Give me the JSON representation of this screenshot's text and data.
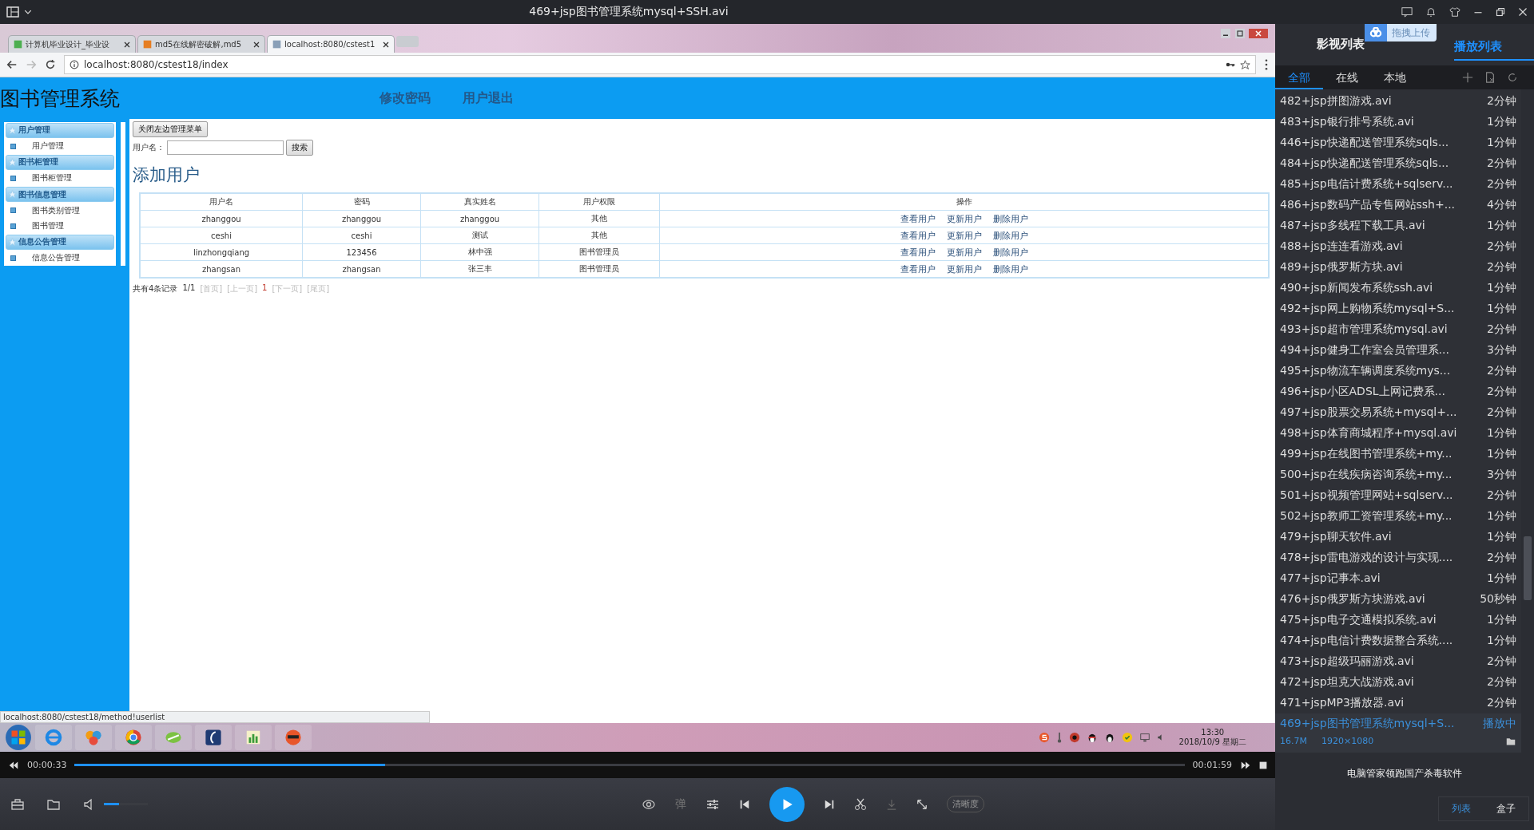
{
  "player": {
    "title": "469+jsp图书管理系统mysql+SSH.avi"
  },
  "browser": {
    "tabs": [
      {
        "label": "计算机毕业设计_毕业设",
        "selected": false
      },
      {
        "label": "md5在线解密破解,md5",
        "selected": false
      },
      {
        "label": "localhost:8080/cstest1",
        "selected": true
      }
    ],
    "url": "localhost:8080/cstest18/index",
    "status_url": "localhost:8080/cstest18/method!userlist"
  },
  "site": {
    "title": "图书管理系统",
    "nav": [
      "修改密码",
      "用户退出"
    ],
    "sidebar": [
      {
        "label": "用户管理",
        "children": [
          {
            "label": "用户管理"
          }
        ]
      },
      {
        "label": "图书柜管理",
        "children": [
          {
            "label": "图书柜管理"
          }
        ]
      },
      {
        "label": "图书信息管理",
        "children": [
          {
            "label": "图书类别管理"
          },
          {
            "label": "图书管理"
          }
        ]
      },
      {
        "label": "信息公告管理",
        "children": [
          {
            "label": "信息公告管理"
          }
        ]
      }
    ],
    "close_menu_button": "关闭左边管理菜单",
    "search": {
      "label": "用户名：",
      "button": "搜索"
    },
    "heading": "添加用户",
    "table": {
      "columns": [
        "用户名",
        "密码",
        "真实姓名",
        "用户权限",
        "操作"
      ],
      "rows": [
        {
          "cells": [
            "zhanggou",
            "zhanggou",
            "zhanggou",
            "其他"
          ],
          "actions": [
            "查看用户",
            "更新用户",
            "删除用户"
          ]
        },
        {
          "cells": [
            "ceshi",
            "ceshi",
            "测试",
            "其他"
          ],
          "actions": [
            "查看用户",
            "更新用户",
            "删除用户"
          ]
        },
        {
          "cells": [
            "linzhongqiang",
            "123456",
            "林中强",
            "图书管理员"
          ],
          "actions": [
            "查看用户",
            "更新用户",
            "删除用户"
          ]
        },
        {
          "cells": [
            "zhangsan",
            "zhangsan",
            "张三丰",
            "图书管理员"
          ],
          "actions": [
            "查看用户",
            "更新用户",
            "删除用户"
          ]
        }
      ]
    },
    "pagination": {
      "summary": "共有4条记录",
      "pages": "1/1",
      "links": [
        {
          "label": "[首页]",
          "kind": "disabled"
        },
        {
          "label": "[上一页]",
          "kind": "disabled"
        },
        {
          "label": "1",
          "kind": "current"
        },
        {
          "label": "[下一页]",
          "kind": "disabled"
        },
        {
          "label": "[尾页]",
          "kind": "disabled"
        }
      ]
    }
  },
  "taskbar": {
    "time": "13:30",
    "date": "2018/10/9 星期二"
  },
  "playback": {
    "elapsed": "00:00:33",
    "total": "00:01:59",
    "level": 0.28,
    "volume": {
      "level": 0.35
    },
    "danmaku": "弹",
    "quality": "清晰度"
  },
  "panel": {
    "tabs": [
      {
        "label": "影视列表",
        "selected": false
      },
      {
        "label": "播放列表",
        "selected": true
      }
    ],
    "upload_button": "拖拽上传",
    "filters": [
      {
        "label": "全部",
        "selected": true
      },
      {
        "label": "在线",
        "selected": false
      },
      {
        "label": "本地",
        "selected": false
      }
    ],
    "items": [
      {
        "title": "482+jsp拼图游戏.avi",
        "duration": "2分钟",
        "selected": false
      },
      {
        "title": "483+jsp银行排号系统.avi",
        "duration": "1分钟",
        "selected": false
      },
      {
        "title": "446+jsp快递配送管理系统sqls...",
        "duration": "1分钟",
        "selected": false
      },
      {
        "title": "484+jsp快递配送管理系统sqls...",
        "duration": "2分钟",
        "selected": false
      },
      {
        "title": "485+jsp电信计费系统+sqlserv...",
        "duration": "2分钟",
        "selected": false
      },
      {
        "title": "486+jsp数码产品专售网站ssh+...",
        "duration": "4分钟",
        "selected": false
      },
      {
        "title": "487+jsp多线程下载工具.avi",
        "duration": "1分钟",
        "selected": false
      },
      {
        "title": "488+jsp连连看游戏.avi",
        "duration": "2分钟",
        "selected": false
      },
      {
        "title": "489+jsp俄罗斯方块.avi",
        "duration": "2分钟",
        "selected": false
      },
      {
        "title": "490+jsp新闻发布系统ssh.avi",
        "duration": "1分钟",
        "selected": false
      },
      {
        "title": "492+jsp网上购物系统mysql+S...",
        "duration": "1分钟",
        "selected": false
      },
      {
        "title": "493+jsp超市管理系统mysql.avi",
        "duration": "2分钟",
        "selected": false
      },
      {
        "title": "494+jsp健身工作室会员管理系...",
        "duration": "3分钟",
        "selected": false
      },
      {
        "title": "495+jsp物流车辆调度系统mys...",
        "duration": "2分钟",
        "selected": false
      },
      {
        "title": "496+jsp小区ADSL上网记费系...",
        "duration": "2分钟",
        "selected": false
      },
      {
        "title": "497+jsp股票交易系统+mysql+...",
        "duration": "2分钟",
        "selected": false
      },
      {
        "title": "498+jsp体育商城程序+mysql.avi",
        "duration": "1分钟",
        "selected": false
      },
      {
        "title": "499+jsp在线图书管理系统+my...",
        "duration": "1分钟",
        "selected": false
      },
      {
        "title": "500+jsp在线疾病咨询系统+my...",
        "duration": "3分钟",
        "selected": false
      },
      {
        "title": "501+jsp视频管理网站+sqlserv...",
        "duration": "2分钟",
        "selected": false
      },
      {
        "title": "502+jsp教师工资管理系统+my...",
        "duration": "1分钟",
        "selected": false
      },
      {
        "title": "479+jsp聊天软件.avi",
        "duration": "1分钟",
        "selected": false
      },
      {
        "title": "478+jsp雷电游戏的设计与实现....",
        "duration": "2分钟",
        "selected": false
      },
      {
        "title": "477+jsp记事本.avi",
        "duration": "1分钟",
        "selected": false
      },
      {
        "title": "476+jsp俄罗斯方块游戏.avi",
        "duration": "50秒钟",
        "selected": false
      },
      {
        "title": "475+jsp电子交通模拟系统.avi",
        "duration": "1分钟",
        "selected": false
      },
      {
        "title": "474+jsp电信计费数据整合系统....",
        "duration": "1分钟",
        "selected": false
      },
      {
        "title": "473+jsp超级玛丽游戏.avi",
        "duration": "2分钟",
        "selected": false
      },
      {
        "title": "472+jsp坦克大战游戏.avi",
        "duration": "2分钟",
        "selected": false
      },
      {
        "title": "471+jspMP3播放器.avi",
        "duration": "2分钟",
        "selected": false
      },
      {
        "title": "469+jsp图书管理系统mysql+S...",
        "duration": "播放中",
        "selected": true
      }
    ],
    "now_playing": {
      "size": "16.7M",
      "resolution": "1920×1080"
    },
    "ad": "电脑管家领跑国产杀毒软件",
    "views": [
      {
        "label": "列表",
        "selected": true
      },
      {
        "label": "盒子",
        "selected": false
      }
    ]
  }
}
